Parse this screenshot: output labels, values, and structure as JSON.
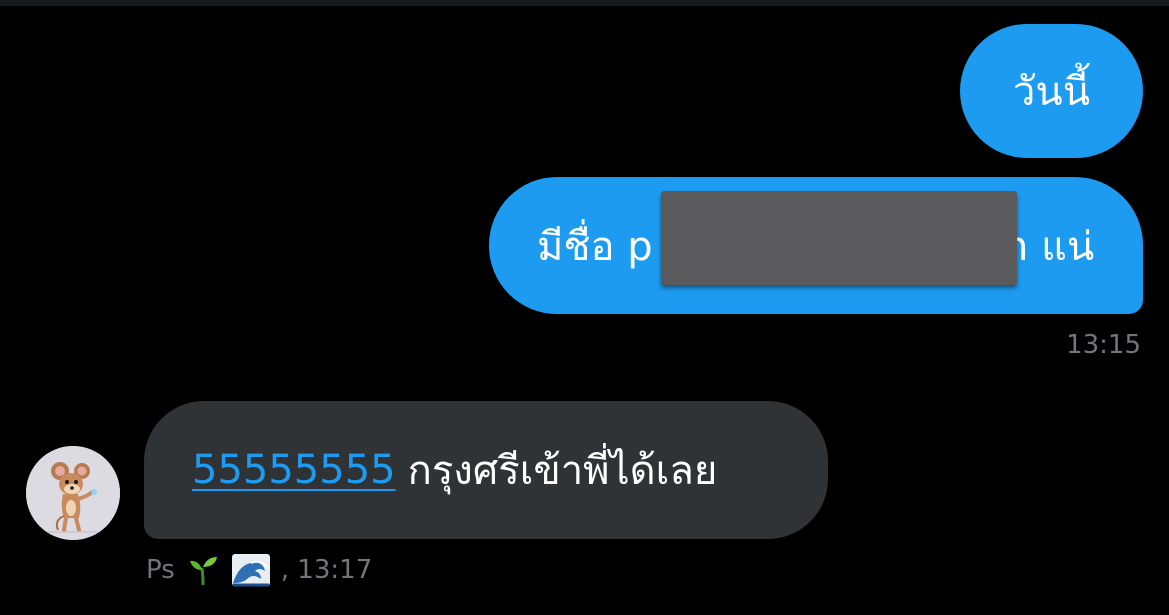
{
  "conversation": {
    "messages": [
      {
        "direction": "outgoing",
        "text": "วันนี้"
      },
      {
        "direction": "outgoing",
        "text_before": "มีชื่อ p",
        "text_after": "n แน่",
        "timestamp": "13:15"
      },
      {
        "direction": "incoming",
        "link_text": "55555555",
        "text": "กรุงศรีเข้าพี่ได้เลย",
        "sender": "Ps",
        "timestamp": ", 13:17"
      }
    ]
  },
  "icons": {
    "sender_emojis": [
      "seedling-emoji-icon",
      "wave-emoji-icon"
    ],
    "avatar": "jerry-mouse-avatar"
  },
  "colors": {
    "background": "#000000",
    "outgoing_bubble": "#1d9bf0",
    "incoming_bubble": "#2f3336",
    "link": "#1d9bf0",
    "meta_text": "#71767b",
    "redaction": "#5a5a5c"
  }
}
